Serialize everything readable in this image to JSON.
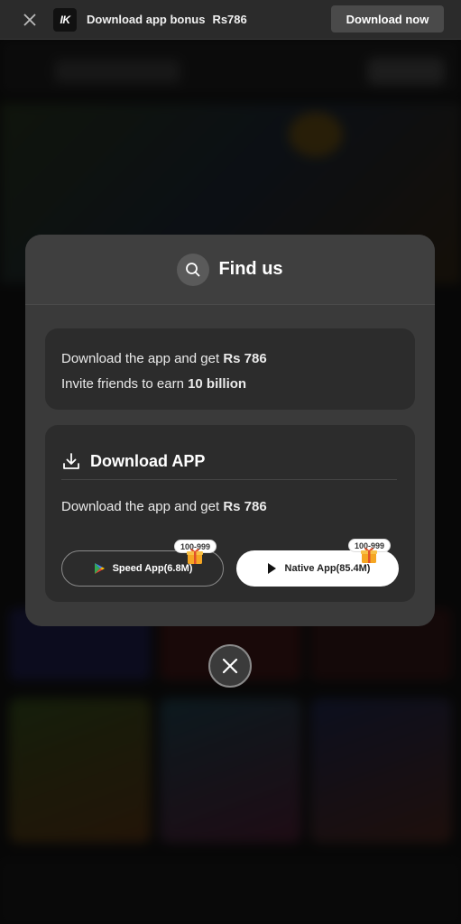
{
  "banner": {
    "close_icon": "close-icon",
    "logo_text": "IK",
    "text": "Download app bonus",
    "amount": "Rs786",
    "button_label": "Download now"
  },
  "modal": {
    "title": "Find us",
    "title_icon": "search-icon",
    "promo": {
      "line1_prefix": "Download the app and get ",
      "line1_amount": "Rs 786",
      "line2_prefix": "Invite friends to earn ",
      "line2_amount": "10 billion"
    },
    "download": {
      "icon": "download-icon",
      "title": "Download APP",
      "sub_prefix": "Download the app and get ",
      "sub_amount": "Rs 786",
      "speed_app": {
        "label": "Speed App(6.8M)",
        "badge": "100-999",
        "icon": "google-play-icon"
      },
      "native_app": {
        "label": "Native App(85.4M)",
        "badge": "100-999",
        "icon": "play-icon"
      }
    },
    "close_icon": "close-icon"
  },
  "colors": {
    "banner_bg": "#2b2b2b",
    "modal_bg": "#3a3a3a",
    "card_bg": "#2c2c2c",
    "native_btn_bg": "#ffffff"
  }
}
